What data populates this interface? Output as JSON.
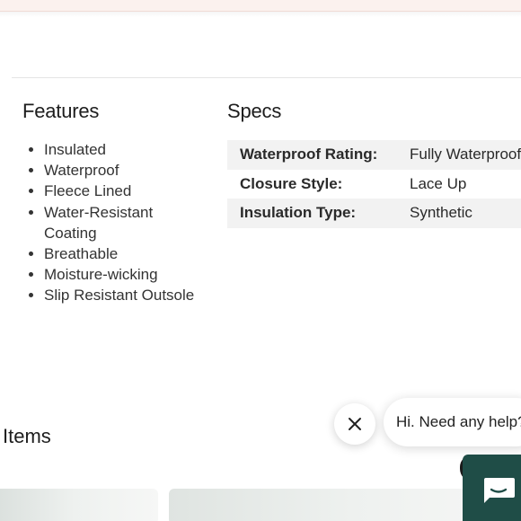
{
  "features": {
    "title": "Features",
    "items": [
      "Insulated",
      "Waterproof",
      "Fleece Lined",
      "Water-Resistant Coating",
      "Breathable",
      "Moisture-wicking",
      "Slip Resistant Outsole"
    ]
  },
  "specs": {
    "title": "Specs",
    "rows": [
      {
        "label": "Waterproof Rating:",
        "value": "Fully Waterproof"
      },
      {
        "label": "Closure Style:",
        "value": "Lace Up"
      },
      {
        "label": "Insulation Type:",
        "value": "Synthetic"
      }
    ]
  },
  "items_section": {
    "title": "Items"
  },
  "chat": {
    "greeting": "Hi. Need any help?",
    "close_icon": "close-icon",
    "launcher_icon": "chat-icon",
    "launcher_color": "#1f4d47"
  }
}
